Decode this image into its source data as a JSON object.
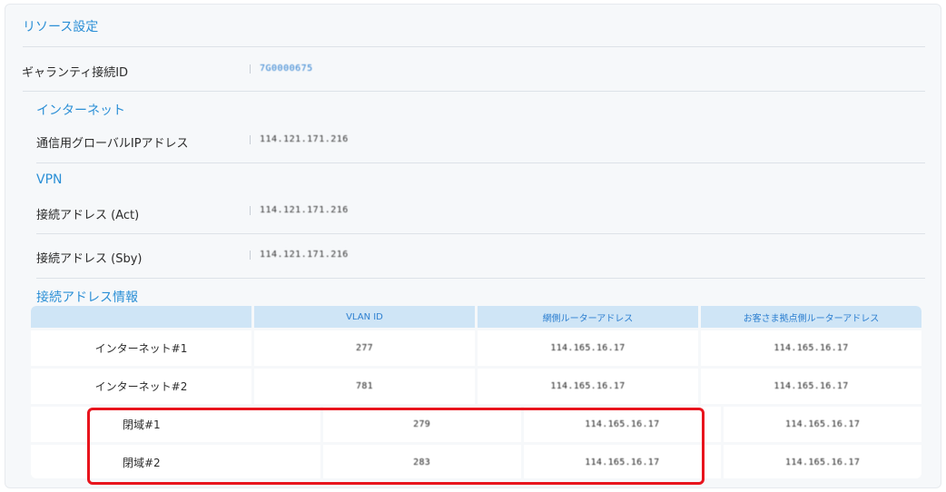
{
  "panel": {
    "title": "リソース設定"
  },
  "guarantee": {
    "label": "ギャランティ接続ID",
    "value": "7G0000675"
  },
  "internet": {
    "section_title": "インターネット",
    "global_ip_label": "通信用グローバルIPアドレス",
    "global_ip_value": "114.121.171.216"
  },
  "vpn": {
    "section_title": "VPN",
    "act_label": "接続アドレス (Act)",
    "act_value": "114.121.171.216",
    "sby_label": "接続アドレス (Sby)",
    "sby_value": "114.121.171.216"
  },
  "connection": {
    "section_title": "接続アドレス情報",
    "headers": [
      "",
      "VLAN ID",
      "網側ルーターアドレス",
      "お客さま拠点側ルーターアドレス"
    ],
    "rows": [
      {
        "name": "インターネット#1",
        "vlan": "277",
        "network_router": "114.165.16.17",
        "customer_router": "114.165.16.17"
      },
      {
        "name": "インターネット#2",
        "vlan": "781",
        "network_router": "114.165.16.17",
        "customer_router": "114.165.16.17"
      },
      {
        "name": "閉域#1",
        "vlan": "279",
        "network_router": "114.165.16.17",
        "customer_router": "114.165.16.17"
      },
      {
        "name": "閉域#2",
        "vlan": "283",
        "network_router": "114.165.16.17",
        "customer_router": "114.165.16.17"
      }
    ]
  },
  "colors": {
    "accent": "#2b8fd6",
    "header_bg": "#cfe5f6",
    "highlight": "#e8141d"
  }
}
